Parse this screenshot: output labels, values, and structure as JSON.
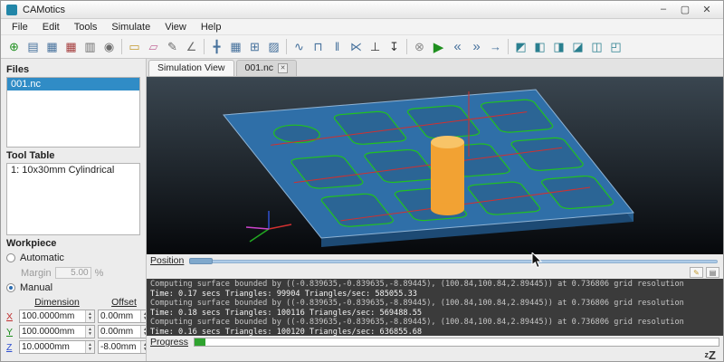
{
  "window": {
    "title": "CAMotics",
    "logo_style": "background:#2286a8",
    "controls": [
      {
        "name": "minimize",
        "glyph": "–"
      },
      {
        "name": "maximize",
        "glyph": "▢"
      },
      {
        "name": "close",
        "glyph": "✕"
      }
    ]
  },
  "menu": {
    "items": [
      "File",
      "Edit",
      "Tools",
      "Simulate",
      "View",
      "Help"
    ]
  },
  "toolbar": {
    "items": [
      {
        "name": "new-project",
        "glyph": "⊕",
        "style": "color:#1f8f1f"
      },
      {
        "name": "open-project",
        "glyph": "▤",
        "style": "color:#46719c"
      },
      {
        "name": "save-project",
        "glyph": "▦",
        "style": "color:#46719c"
      },
      {
        "name": "save-file",
        "glyph": "▦",
        "style": "color:#a33a3a"
      },
      {
        "name": "export",
        "glyph": "▥",
        "style": "color:#6b6b6b"
      },
      {
        "name": "snapshot",
        "glyph": "◉",
        "style": "color:#6b6b6b"
      },
      {
        "name": "toggle-console",
        "glyph": "▭",
        "style": "color:#c2992d"
      },
      {
        "name": "clear-surface",
        "glyph": "▱",
        "style": "color:#c26b9a"
      },
      {
        "name": "edit-file",
        "glyph": "✎",
        "style": "color:#6b6b6b"
      },
      {
        "name": "measure",
        "glyph": "∠",
        "style": "color:#6b6b6b"
      },
      {
        "name": "show-axes",
        "glyph": "╋",
        "style": "color:#46719c"
      },
      {
        "name": "show-bounds",
        "glyph": "▦",
        "style": "color:#46719c"
      },
      {
        "name": "show-grid",
        "glyph": "⊞",
        "style": "color:#46719c"
      },
      {
        "name": "show-surface",
        "glyph": "▨",
        "style": "color:#46719c"
      },
      {
        "name": "show-toolpath",
        "glyph": "∿",
        "style": "color:#46719c"
      },
      {
        "name": "path-intensity",
        "glyph": "⊓",
        "style": "color:#46719c"
      },
      {
        "name": "path-marks",
        "glyph": "‖",
        "style": "color:#46719c"
      },
      {
        "name": "jog",
        "glyph": "⋉",
        "style": "color:#46719c"
      },
      {
        "name": "plumb",
        "glyph": "⊥",
        "style": "color:#333333"
      },
      {
        "name": "tool-position",
        "glyph": "↧",
        "style": "color:#333333"
      },
      {
        "name": "stop",
        "glyph": "⊗",
        "style": "color:#8a8a8a"
      },
      {
        "name": "run",
        "glyph": "▶",
        "style": "color:#1f8f1f"
      },
      {
        "name": "step-back",
        "glyph": "«",
        "style": "color:#46719c"
      },
      {
        "name": "step-forward",
        "glyph": "»",
        "style": "color:#46719c"
      },
      {
        "name": "run-to-end",
        "glyph": "→",
        "style": "color:#46719c"
      },
      {
        "name": "view-isometric",
        "glyph": "◩",
        "style": "color:#2a7f8f"
      },
      {
        "name": "view-front",
        "glyph": "◧",
        "style": "color:#2a7f8f"
      },
      {
        "name": "view-back",
        "glyph": "◨",
        "style": "color:#2a7f8f"
      },
      {
        "name": "view-left",
        "glyph": "◪",
        "style": "color:#2a7f8f"
      },
      {
        "name": "view-right",
        "glyph": "◫",
        "style": "color:#2a7f8f"
      },
      {
        "name": "view-top",
        "glyph": "◰",
        "style": "color:#2a7f8f"
      }
    ]
  },
  "sidebar": {
    "files": {
      "header": "Files",
      "selected_item": "001.nc"
    },
    "tool_table": {
      "header": "Tool Table",
      "item": "1: 10x30mm Cylindrical"
    },
    "workpiece": {
      "header": "Workpiece",
      "automatic_label": "Automatic",
      "margin_label": "Margin",
      "margin_value": "5.00",
      "margin_unit": "%",
      "manual_label": "Manual",
      "col_dimension": "Dimension",
      "col_offset": "Offset",
      "rows": [
        {
          "axis": "X",
          "axis_style": "color:#c03030;text-decoration:underline",
          "dimension": "100.0000mm",
          "offset": "0.00mm"
        },
        {
          "axis": "Y",
          "axis_style": "color:#1f8f1f;text-decoration:underline",
          "dimension": "100.0000mm",
          "offset": "0.00mm"
        },
        {
          "axis": "Z",
          "axis_style": "color:#2f4fd0;text-decoration:underline",
          "dimension": "10.0000mm",
          "offset": "-8.00mm"
        }
      ]
    }
  },
  "ui": {
    "spin_up": "▲",
    "spin_down": "▼"
  },
  "main": {
    "tabs": [
      {
        "label": "Simulation View"
      },
      {
        "label": "001.nc"
      }
    ],
    "close_glyph": "✕",
    "position_label": "Position",
    "console_buttons": [
      {
        "name": "clear-console",
        "glyph": "✎",
        "style": "color:#c2992d"
      },
      {
        "name": "export-log",
        "glyph": "▤",
        "style": "color:#555555"
      }
    ],
    "console_lines": [
      "Computing surface bounded by ((-0.839635,-0.839635,-8.89445), (100.84,100.84,2.89445)) at 0.736806 grid resolution",
      "Time: 0.17 secs Triangles: 99904 Triangles/sec: 585055.33",
      "Computing surface bounded by ((-0.839635,-0.839635,-8.89445), (100.84,100.84,2.89445)) at 0.736806 grid resolution",
      "Time: 0.18 secs Triangles: 100116 Triangles/sec: 569488.55",
      "Computing surface bounded by ((-0.839635,-0.839635,-8.89445), (100.84,100.84,2.89445)) at 0.736806 grid resolution",
      "Time: 0.16 secs Triangles: 100120 Triangles/sec: 636855.68"
    ],
    "progress": {
      "label": "Progress",
      "fill_style": "width:2%"
    },
    "logo_small": "z",
    "logo_big": "Z"
  },
  "scene": {
    "bg_top": "#3a4650",
    "bg_bottom": "#06080b",
    "workpiece_top": "#2f6fa8",
    "workpiece_front": "#1d4a74",
    "workpiece_side": "#265d8d",
    "pocket_stroke": "#21c21f",
    "pocket_fill": "#28587f",
    "toolpath": "#d03030",
    "tool_body": "#f2a233",
    "tool_top": "#f8c468",
    "axis_x": "#d03030",
    "axis_y": "#22aa22",
    "axis_z": "#3050d0",
    "axis_m": "#cc44cc"
  }
}
